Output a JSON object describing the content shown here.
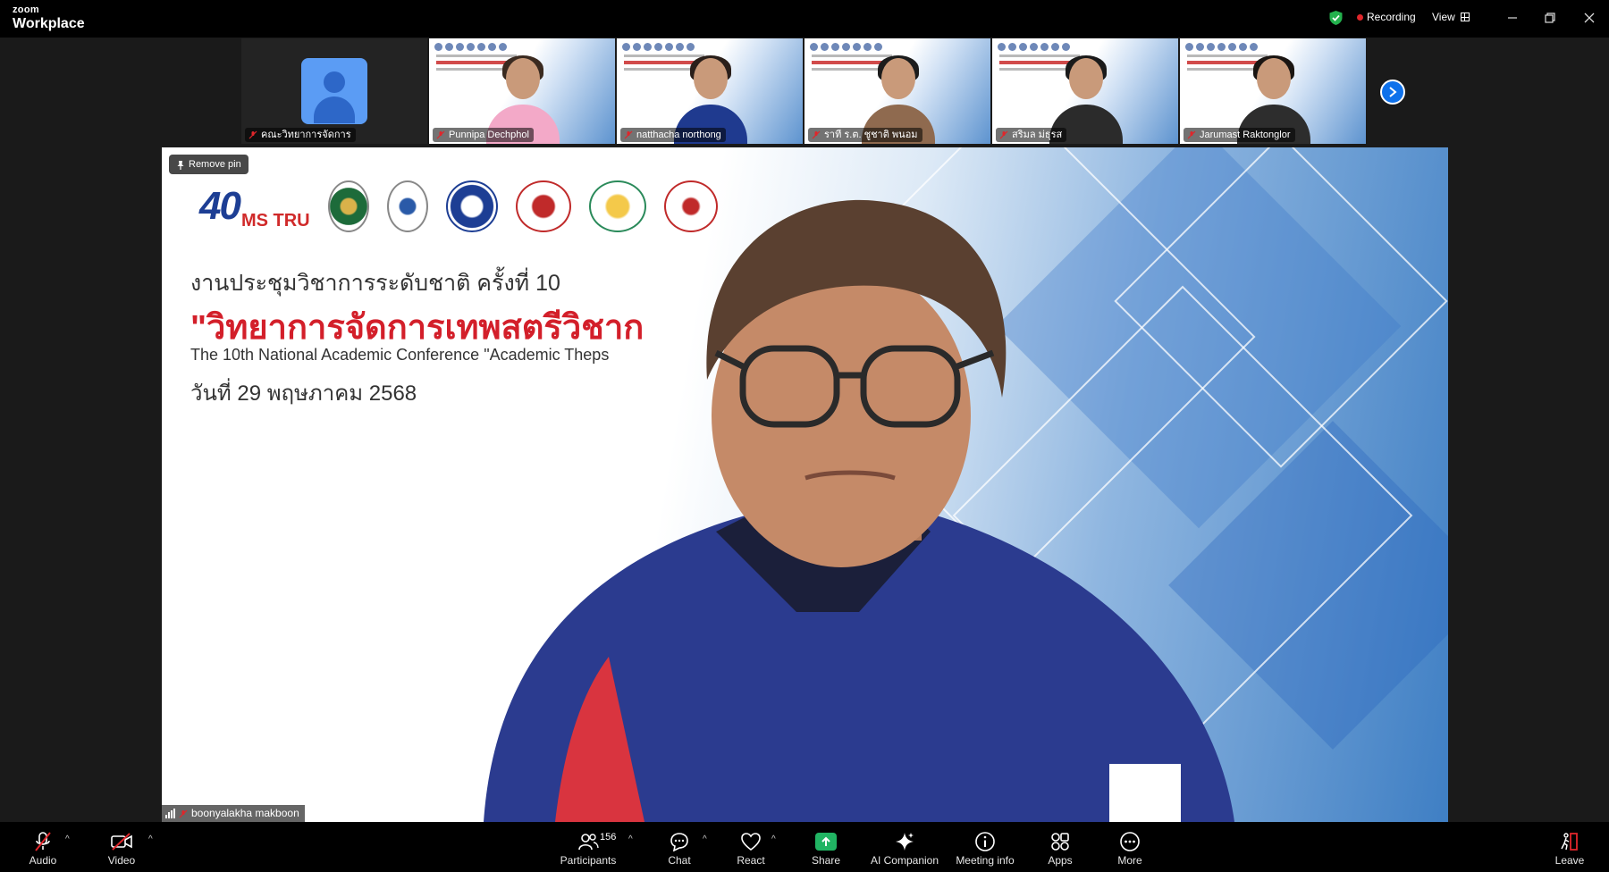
{
  "titlebar": {
    "brand_small": "zoom",
    "brand_large": "Workplace",
    "recording_label": "Recording",
    "view_label": "View"
  },
  "gallery": {
    "tiles": [
      {
        "name": "คณะวิทยาการจัดการ",
        "type": "avatar"
      },
      {
        "name": "Punnipa Dechphol",
        "type": "video",
        "shirt": "#f3a9c8",
        "hair": "#3a2a20"
      },
      {
        "name": "natthacha northong",
        "type": "video",
        "shirt": "#1f3a8f",
        "hair": "#2a1f1a"
      },
      {
        "name": "ราที ร.ต. ชูชาติ พนอม",
        "type": "video",
        "shirt": "#8f6a4f",
        "hair": "#1c1c1c"
      },
      {
        "name": "สริมล ม่ธุรส",
        "type": "video",
        "shirt": "#2b2b2b",
        "hair": "#1a1a1a"
      },
      {
        "name": "Jarumast Raktonglor",
        "type": "video",
        "shirt": "#2d2d2d",
        "hair": "#1a1512"
      }
    ]
  },
  "main": {
    "pin_label": "Remove pin",
    "logo_text": "40",
    "logo_sub": "MS TRU",
    "heading_1": "งานประชุมวิชาการระดับชาติ ครั้งที่ 10",
    "heading_2": "\"วิทยาการจัดการเทพสตรีวิชาก",
    "heading_3": "The 10th National Academic Conference \"Academic Theps",
    "heading_4": "วันที่ 29 พฤษภาคม 2568",
    "speaker_name": "boonyalakha makboon"
  },
  "toolbar": {
    "audio": "Audio",
    "video": "Video",
    "participants": "Participants",
    "participants_count": "156",
    "chat": "Chat",
    "react": "React",
    "share": "Share",
    "ai_companion": "AI Companion",
    "meeting_info": "Meeting info",
    "apps": "Apps",
    "more": "More",
    "leave": "Leave"
  },
  "colors": {
    "accent_blue": "#0e71eb",
    "record_red": "#e0262b",
    "share_green": "#21b463",
    "muted_red": "#e0262b"
  }
}
